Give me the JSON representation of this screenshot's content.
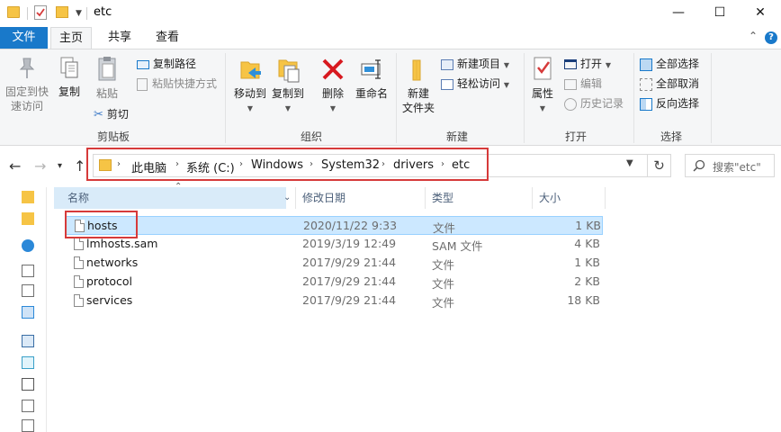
{
  "window": {
    "title": "etc",
    "minimize": "—",
    "maximize": "☐",
    "close": "✕"
  },
  "tabs": {
    "file": "文件",
    "home": "主页",
    "share": "共享",
    "view": "查看"
  },
  "ribbon": {
    "clipboard": {
      "label": "剪贴板",
      "pin": [
        "固定到快",
        "速访问"
      ],
      "copy": "复制",
      "paste": "粘贴",
      "copy_path": "复制路径",
      "paste_shortcut": "粘贴快捷方式",
      "cut": "剪切"
    },
    "organize": {
      "label": "组织",
      "move_to": "移动到",
      "copy_to": "复制到",
      "delete": "删除",
      "rename": "重命名"
    },
    "new": {
      "label": "新建",
      "new_folder": [
        "新建",
        "文件夹"
      ],
      "new_item": "新建项目",
      "easy_access": "轻松访问"
    },
    "open": {
      "label": "打开",
      "properties": "属性",
      "open": "打开",
      "edit": "编辑",
      "history": "历史记录"
    },
    "select": {
      "label": "选择",
      "select_all": "全部选择",
      "select_none": "全部取消",
      "invert": "反向选择"
    }
  },
  "address": {
    "crumbs": [
      "此电脑",
      "系统 (C:)",
      "Windows",
      "System32",
      "drivers",
      "etc"
    ],
    "search_placeholder": "搜索\"etc\""
  },
  "columns": {
    "name": "名称",
    "modified": "修改日期",
    "type": "类型",
    "size": "大小"
  },
  "files": [
    {
      "name": "hosts",
      "modified": "2020/11/22 9:33",
      "type": "文件",
      "size": "1 KB",
      "selected": true
    },
    {
      "name": "lmhosts.sam",
      "modified": "2019/3/19 12:49",
      "type": "SAM 文件",
      "size": "4 KB"
    },
    {
      "name": "networks",
      "modified": "2017/9/29 21:44",
      "type": "文件",
      "size": "1 KB"
    },
    {
      "name": "protocol",
      "modified": "2017/9/29 21:44",
      "type": "文件",
      "size": "2 KB"
    },
    {
      "name": "services",
      "modified": "2017/9/29 21:44",
      "type": "文件",
      "size": "18 KB"
    }
  ],
  "accent_color": "#1979ca",
  "highlight_color": "#d63a3a",
  "selection_color": "#cce8ff"
}
